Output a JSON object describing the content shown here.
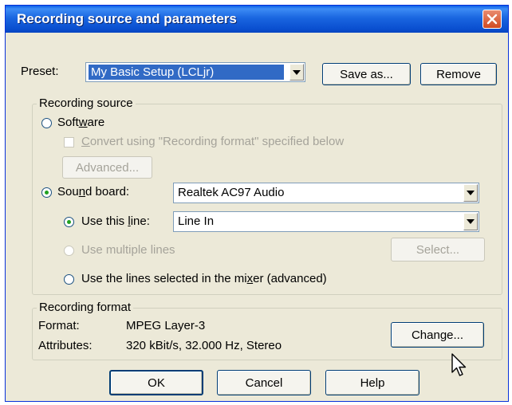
{
  "window": {
    "title": "Recording source and parameters"
  },
  "preset": {
    "label": "Preset:",
    "value": "My Basic Setup (LCLjr)",
    "save_as": "Save as...",
    "remove": "Remove"
  },
  "recording_source": {
    "group_label": "Recording source",
    "software": {
      "pre": "Soft",
      "u": "w",
      "post": "are"
    },
    "convert": {
      "u": "C",
      "post": "onvert using \"Recording format\" specified below"
    },
    "advanced": "Advanced...",
    "sound_board": {
      "pre": "Sou",
      "u": "n",
      "post": "d board:",
      "value": "Realtek AC97 Audio"
    },
    "use_this_line": {
      "pre": "Use this ",
      "u": "l",
      "post": "ine:",
      "value": "Line In"
    },
    "use_multiple": "Use multiple lines",
    "select": "Select...",
    "use_mixer": {
      "pre": "Use the lines selected in the mi",
      "u": "x",
      "post": "er (advanced)"
    }
  },
  "recording_format": {
    "group_label": "Recording format",
    "format_label": "Format:",
    "format_value": "MPEG Layer-3",
    "attributes_label": "Attributes:",
    "attributes_value": "320 kBit/s, 32.000 Hz, Stereo",
    "change": "Change..."
  },
  "footer": {
    "ok": "OK",
    "cancel": "Cancel",
    "help": "Help"
  },
  "colors": {
    "titlebar": "#0a5fe8",
    "dialog_bg": "#ece9d8",
    "selection": "#316ac5",
    "close": "#d04a22"
  }
}
